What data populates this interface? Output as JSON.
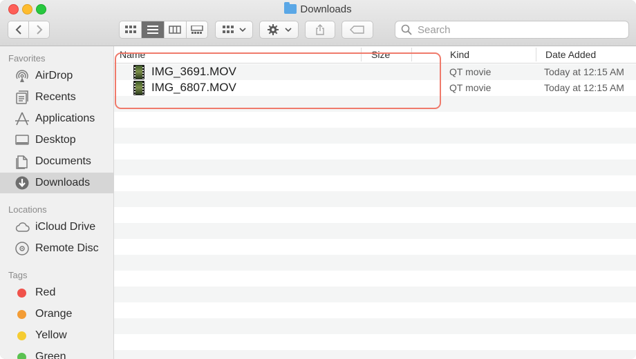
{
  "window": {
    "title": "Downloads"
  },
  "toolbar": {
    "search_placeholder": "Search",
    "back_icon": "chevron-left-icon",
    "forward_icon": "chevron-right-icon"
  },
  "sidebar": {
    "favorites_header": "Favorites",
    "favorites": [
      {
        "label": "AirDrop",
        "icon": "airdrop-icon"
      },
      {
        "label": "Recents",
        "icon": "recents-icon"
      },
      {
        "label": "Applications",
        "icon": "applications-icon"
      },
      {
        "label": "Desktop",
        "icon": "desktop-icon"
      },
      {
        "label": "Documents",
        "icon": "documents-icon"
      },
      {
        "label": "Downloads",
        "icon": "downloads-icon",
        "selected": true
      }
    ],
    "locations_header": "Locations",
    "locations": [
      {
        "label": "iCloud Drive",
        "icon": "cloud-icon"
      },
      {
        "label": "Remote Disc",
        "icon": "disc-icon"
      }
    ],
    "tags_header": "Tags",
    "tags": [
      {
        "label": "Red",
        "color": "#f0524b"
      },
      {
        "label": "Orange",
        "color": "#f39c35"
      },
      {
        "label": "Yellow",
        "color": "#f5cc32"
      },
      {
        "label": "Green",
        "color": "#5cc152"
      }
    ]
  },
  "list": {
    "columns": {
      "name": "Name",
      "size": "Size",
      "kind": "Kind",
      "date_added": "Date Added"
    },
    "rows": [
      {
        "name": "IMG_3691.MOV",
        "kind": "QT movie",
        "date_added": "Today at 12:15 AM"
      },
      {
        "name": "IMG_6807.MOV",
        "kind": "QT movie",
        "date_added": "Today at 12:15 AM"
      }
    ]
  },
  "colors": {
    "accent_highlight": "#ef7a6b",
    "selected_sidebar": "#d6d6d6"
  }
}
